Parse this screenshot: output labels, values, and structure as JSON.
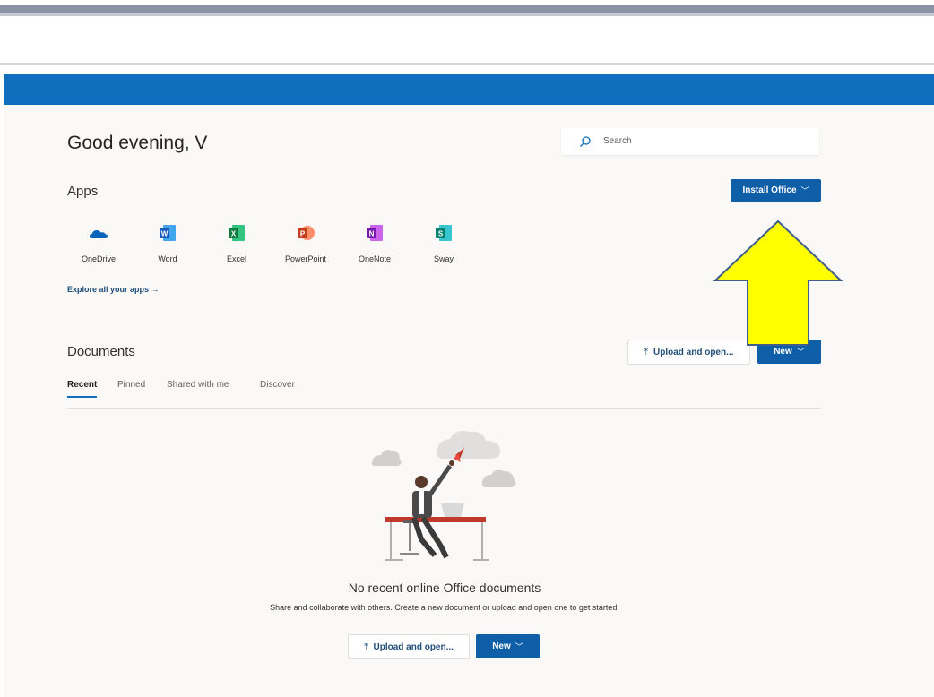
{
  "header": {
    "greeting": "Good evening, V"
  },
  "search": {
    "placeholder": "Search"
  },
  "apps": {
    "title": "Apps",
    "install_label": "Install Office",
    "items": [
      {
        "name": "OneDrive",
        "icon": "onedrive-icon",
        "color": "#0364b8"
      },
      {
        "name": "Word",
        "icon": "word-icon",
        "color": "#185abd"
      },
      {
        "name": "Excel",
        "icon": "excel-icon",
        "color": "#107c41"
      },
      {
        "name": "PowerPoint",
        "icon": "powerpoint-icon",
        "color": "#c43e1c"
      },
      {
        "name": "OneNote",
        "icon": "onenote-icon",
        "color": "#7719aa"
      },
      {
        "name": "Sway",
        "icon": "sway-icon",
        "color": "#008272"
      }
    ],
    "explore_label": "Explore all your apps →"
  },
  "documents": {
    "title": "Documents",
    "upload_label": "Upload and open...",
    "new_label": "New",
    "tabs": [
      {
        "label": "Recent",
        "active": true
      },
      {
        "label": "Pinned",
        "active": false
      },
      {
        "label": "Shared with me",
        "active": false
      },
      {
        "label": "Discover",
        "active": false
      }
    ],
    "empty": {
      "title": "No recent online Office documents",
      "description": "Share and collaborate with others. Create a new document or upload and open one to get started.",
      "upload_label": "Upload and open...",
      "new_label": "New"
    }
  },
  "annotation": {
    "icon": "yellow-arrow-up-icon",
    "color": "#ffff00"
  },
  "colors": {
    "brand": "#106ebe",
    "primary_button": "#0f5ea8",
    "background": "#faf9f8"
  }
}
